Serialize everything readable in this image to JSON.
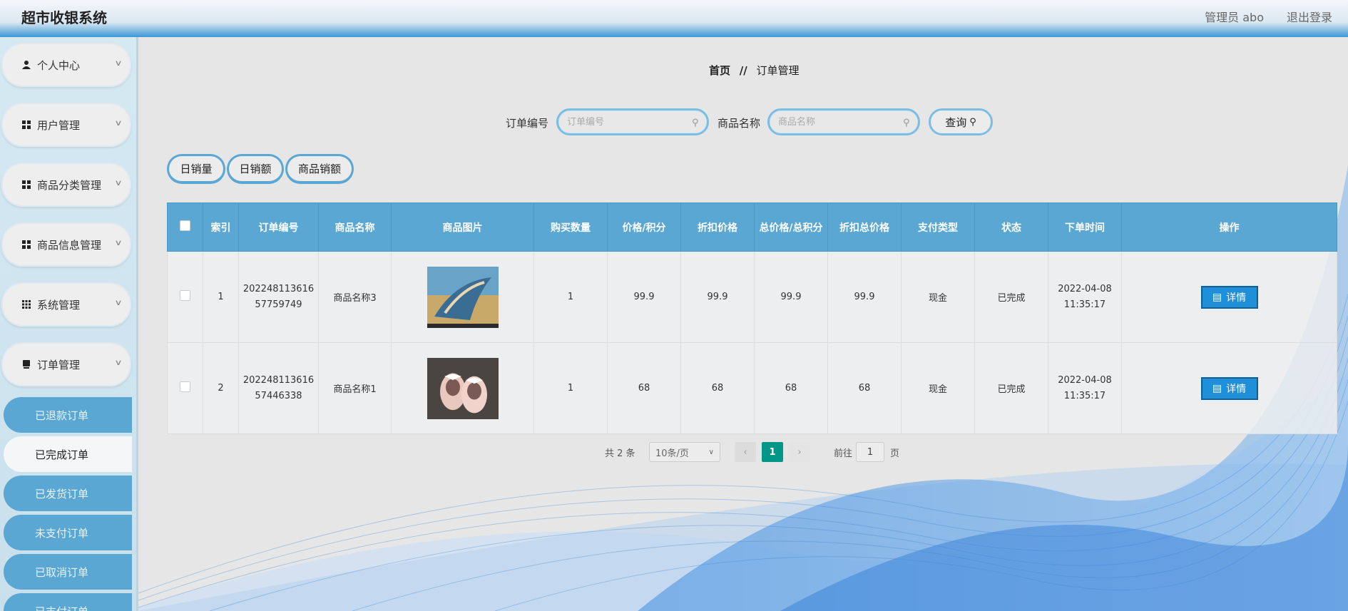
{
  "app": {
    "title": "超市收银系统"
  },
  "header": {
    "user": "管理员 abo",
    "logout": "退出登录"
  },
  "sidebar": {
    "items": [
      {
        "label": "个人中心",
        "icon": "user-icon"
      },
      {
        "label": "用户管理",
        "icon": "grid-icon"
      },
      {
        "label": "商品分类管理",
        "icon": "grid-icon"
      },
      {
        "label": "商品信息管理",
        "icon": "grid-icon"
      },
      {
        "label": "系统管理",
        "icon": "grid9-icon"
      },
      {
        "label": "订单管理",
        "icon": "box-icon"
      }
    ],
    "subitems": [
      "已退款订单",
      "已完成订单",
      "已发货订单",
      "未支付订单",
      "已取消订单",
      "已支付订单"
    ],
    "active_subitem": "已完成订单"
  },
  "breadcrumb": {
    "home": "首页",
    "separator": "//",
    "current": "订单管理"
  },
  "search": {
    "order_label": "订单编号",
    "order_placeholder": "订单编号",
    "product_label": "商品名称",
    "product_placeholder": "商品名称",
    "query_label": "查询"
  },
  "actions": {
    "daily_volume": "日销量",
    "daily_amount": "日销额",
    "product_sales": "商品销额"
  },
  "table": {
    "headers": [
      "索引",
      "订单编号",
      "商品名称",
      "商品图片",
      "购买数量",
      "价格/积分",
      "折扣价格",
      "总价格/总积分",
      "折扣总价格",
      "支付类型",
      "状态",
      "下单时间",
      "操作"
    ],
    "rows": [
      {
        "index": "1",
        "order_no": "20224811361657759749",
        "product": "商品名称3",
        "qty": "1",
        "price": "99.9",
        "discount_price": "99.9",
        "total": "99.9",
        "discount_total": "99.9",
        "pay_type": "现金",
        "status": "已完成",
        "time": "2022-04-08 11:35:17",
        "action": "详情"
      },
      {
        "index": "2",
        "order_no": "20224811361657446338",
        "product": "商品名称1",
        "qty": "1",
        "price": "68",
        "discount_price": "68",
        "total": "68",
        "discount_total": "68",
        "pay_type": "现金",
        "status": "已完成",
        "time": "2022-04-08 11:35:17",
        "action": "详情"
      }
    ]
  },
  "pagination": {
    "total_text": "共 2 条",
    "page_size": "10条/页",
    "current_page": "1",
    "goto_label": "前往",
    "goto_value": "1",
    "page_suffix": "页"
  },
  "colors": {
    "accent": "#5aa7d3",
    "detail_button": "#1e8fd8",
    "current_page": "#009688"
  }
}
